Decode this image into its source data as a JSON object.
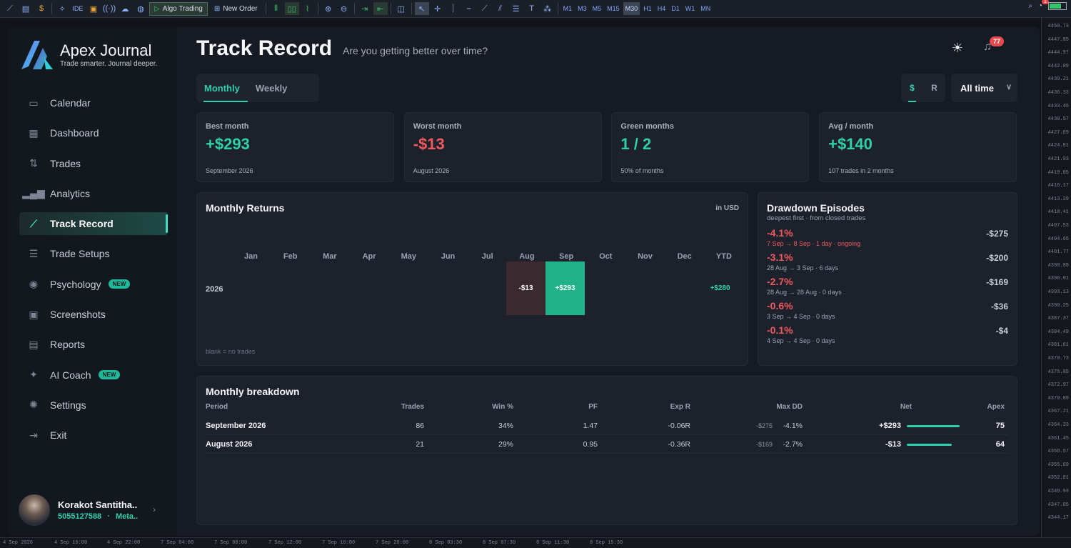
{
  "terminal": {
    "toolbar_buttons": {
      "algo_trading": "Algo Trading",
      "new_order": "New Order",
      "ide": "IDE"
    },
    "timeframes": [
      "M1",
      "M3",
      "M5",
      "M15",
      "M30",
      "H1",
      "H4",
      "D1",
      "W1",
      "MN"
    ],
    "active_timeframe": "M30",
    "notification_count": "1",
    "price_ticks": [
      "4450.73",
      "4447.85",
      "4444.97",
      "4442.09",
      "4439.21",
      "4436.33",
      "4433.45",
      "4430.57",
      "4427.69",
      "4424.81",
      "4421.93",
      "4419.05",
      "4416.17",
      "4413.29",
      "4410.41",
      "4407.53",
      "4404.65",
      "4401.77",
      "4398.89",
      "4396.01",
      "4393.13",
      "4390.25",
      "4387.37",
      "4384.49",
      "4381.61",
      "4378.73",
      "4375.85",
      "4372.97",
      "4370.09",
      "4367.21",
      "4364.33",
      "4361.45",
      "4358.57",
      "4355.69",
      "4352.81",
      "4349.93",
      "4347.05",
      "4344.17"
    ],
    "time_ticks": [
      "4 Sep 2026",
      "4 Sep 16:00",
      "4 Sep 22:00",
      "7 Sep 04:00",
      "7 Sep 08:00",
      "7 Sep 12:00",
      "7 Sep 16:00",
      "7 Sep 20:00",
      "8 Sep 03:30",
      "8 Sep 07:30",
      "8 Sep 11:30",
      "8 Sep 15:30"
    ]
  },
  "brand": {
    "name": "Apex Journal",
    "tagline": "Trade smarter. Journal deeper."
  },
  "nav": [
    {
      "label": "Calendar",
      "icon": "calendar-icon",
      "glyph": "▭",
      "active": false,
      "badge": ""
    },
    {
      "label": "Dashboard",
      "icon": "dashboard-icon",
      "glyph": "▦",
      "active": false,
      "badge": ""
    },
    {
      "label": "Trades",
      "icon": "trades-icon",
      "glyph": "⇅",
      "active": false,
      "badge": ""
    },
    {
      "label": "Analytics",
      "icon": "analytics-icon",
      "glyph": "▂▄▆",
      "active": false,
      "badge": ""
    },
    {
      "label": "Track Record",
      "icon": "track-record-icon",
      "glyph": "⟋",
      "active": true,
      "badge": ""
    },
    {
      "label": "Trade Setups",
      "icon": "sliders-icon",
      "glyph": "☰",
      "active": false,
      "badge": ""
    },
    {
      "label": "Psychology",
      "icon": "psychology-icon",
      "glyph": "◉",
      "active": false,
      "badge": "NEW"
    },
    {
      "label": "Screenshots",
      "icon": "screenshots-icon",
      "glyph": "▣",
      "active": false,
      "badge": ""
    },
    {
      "label": "Reports",
      "icon": "reports-icon",
      "glyph": "▤",
      "active": false,
      "badge": ""
    },
    {
      "label": "AI Coach",
      "icon": "ai-coach-icon",
      "glyph": "✦",
      "active": false,
      "badge": "NEW"
    },
    {
      "label": "Settings",
      "icon": "settings-icon",
      "glyph": "✺",
      "active": false,
      "badge": ""
    },
    {
      "label": "Exit",
      "icon": "exit-icon",
      "glyph": "⇥",
      "active": false,
      "badge": ""
    }
  ],
  "user": {
    "name": "Korakot Santitha..",
    "account": "5055127588",
    "separator": "·",
    "platform": "Meta.."
  },
  "header": {
    "title": "Track Record",
    "subtitle": "Are you getting better over time?",
    "notifications": "77"
  },
  "tabs": [
    {
      "label": "Monthly",
      "active": true
    },
    {
      "label": "Weekly",
      "active": false
    }
  ],
  "units": [
    {
      "label": "$",
      "active": true
    },
    {
      "label": "R",
      "active": false
    }
  ],
  "range": {
    "selected": "All time"
  },
  "stats": [
    {
      "label": "Best month",
      "value": "+$293",
      "tone": "green",
      "sub": "September 2026"
    },
    {
      "label": "Worst month",
      "value": "-$13",
      "tone": "red",
      "sub": "August 2026"
    },
    {
      "label": "Green months",
      "value": "1 / 2",
      "tone": "green",
      "sub": "50% of months"
    },
    {
      "label": "Avg / month",
      "value": "+$140",
      "tone": "green",
      "sub": "107 trades in 2 months"
    }
  ],
  "monthly_returns": {
    "title": "Monthly Returns",
    "unit_label": "in USD",
    "columns": [
      "Jan",
      "Feb",
      "Mar",
      "Apr",
      "May",
      "Jun",
      "Jul",
      "Aug",
      "Sep",
      "Oct",
      "Nov",
      "Dec",
      "YTD"
    ],
    "year": "2026",
    "cells": [
      {
        "month_index": 7,
        "value": "-$13",
        "color": "#3a2a30"
      },
      {
        "month_index": 8,
        "value": "+$293",
        "color": "#1fb387"
      }
    ],
    "ytd": "+$280",
    "note": "blank = no trades"
  },
  "drawdowns": {
    "title": "Drawdown Episodes",
    "subtitle": "deepest first · from closed trades",
    "items": [
      {
        "pct": "-4.1%",
        "amount": "-$275",
        "meta": "7 Sep → 8 Sep · 1 day · ongoing",
        "ongoing": true
      },
      {
        "pct": "-3.1%",
        "amount": "-$200",
        "meta": "28 Aug → 3 Sep · 6 days",
        "ongoing": false
      },
      {
        "pct": "-2.7%",
        "amount": "-$169",
        "meta": "28 Aug → 28 Aug · 0 days",
        "ongoing": false
      },
      {
        "pct": "-0.6%",
        "amount": "-$36",
        "meta": "3 Sep → 4 Sep · 0 days",
        "ongoing": false
      },
      {
        "pct": "-0.1%",
        "amount": "-$4",
        "meta": "4 Sep → 4 Sep · 0 days",
        "ongoing": false
      }
    ]
  },
  "breakdown": {
    "title": "Monthly breakdown",
    "headers": [
      "Period",
      "Trades",
      "Win %",
      "PF",
      "Exp R",
      "Max DD",
      "Net",
      "Apex"
    ],
    "rows": [
      {
        "period": "September 2026",
        "trades": "86",
        "win": "34%",
        "pf": "1.47",
        "exp_r": "-0.06R",
        "max_dd_amt": "-$275",
        "max_dd_pct": "-4.1%",
        "net": "+$293",
        "net_tone": "green",
        "net_fill": 1.0,
        "apex": "75"
      },
      {
        "period": "August 2026",
        "trades": "21",
        "win": "29%",
        "pf": "0.95",
        "exp_r": "-0.36R",
        "max_dd_amt": "-$169",
        "max_dd_pct": "-2.7%",
        "net": "-$13",
        "net_tone": "red",
        "net_fill": 0.85,
        "apex": "64"
      }
    ]
  }
}
